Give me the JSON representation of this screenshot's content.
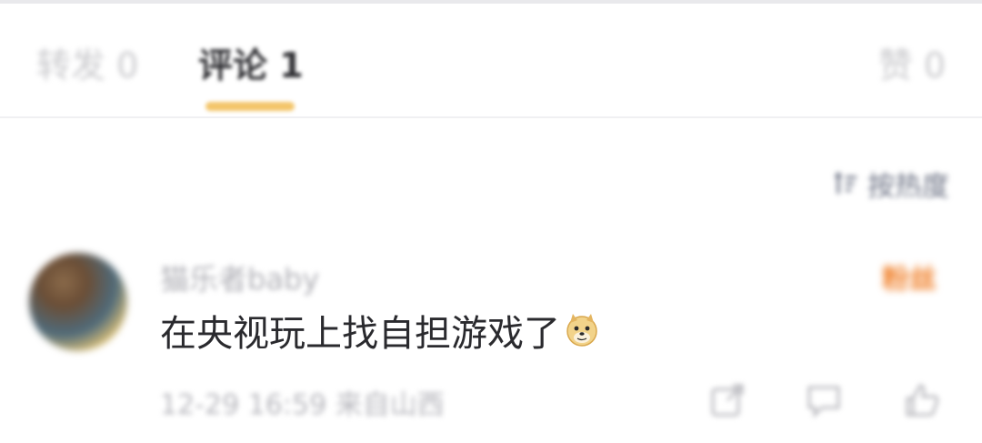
{
  "tabs": {
    "repost_label": "转发 0",
    "comment_label": "评论 1",
    "like_label": "赞 0"
  },
  "sort": {
    "label": "按热度"
  },
  "comment": {
    "username": "猫乐者baby",
    "badge": "粉丝",
    "text": "在央视玩上找自担游戏了",
    "emoji": "doge-icon",
    "meta": "12-29 16:59 来自山西"
  },
  "colors": {
    "accent_indicator": "#f3c56a",
    "badge": "#f07f28"
  }
}
